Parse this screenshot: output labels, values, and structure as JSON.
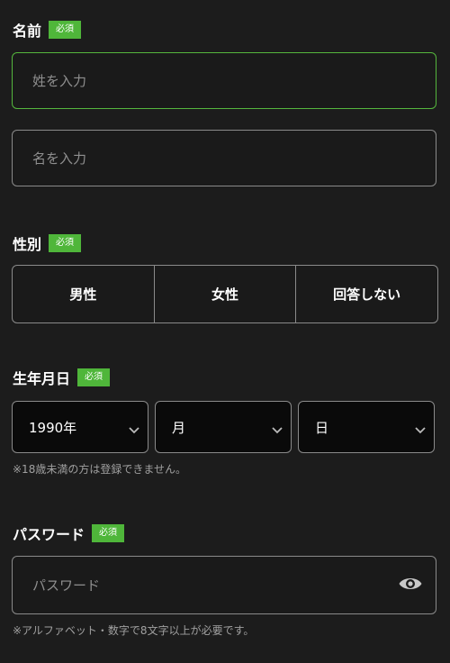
{
  "name_section": {
    "label": "名前",
    "required_badge": "必須",
    "last_name_placeholder": "姓を入力",
    "first_name_placeholder": "名を入力"
  },
  "gender_section": {
    "label": "性別",
    "required_badge": "必須",
    "options": [
      "男性",
      "女性",
      "回答しない"
    ]
  },
  "birthday_section": {
    "label": "生年月日",
    "required_badge": "必須",
    "year_value": "1990年",
    "month_value": "月",
    "day_value": "日",
    "note": "※18歳未満の方は登録できません。"
  },
  "password_section": {
    "label": "パスワード",
    "required_badge": "必須",
    "placeholder": "パスワード",
    "note": "※アルファベット・数字で8文字以上が必要です。",
    "toggle_icon": "eye-icon"
  },
  "colors": {
    "background": "#1c1c1c",
    "badge": "#4fb63a",
    "focused_border": "#55b63d",
    "border": "#8a8a8a"
  }
}
